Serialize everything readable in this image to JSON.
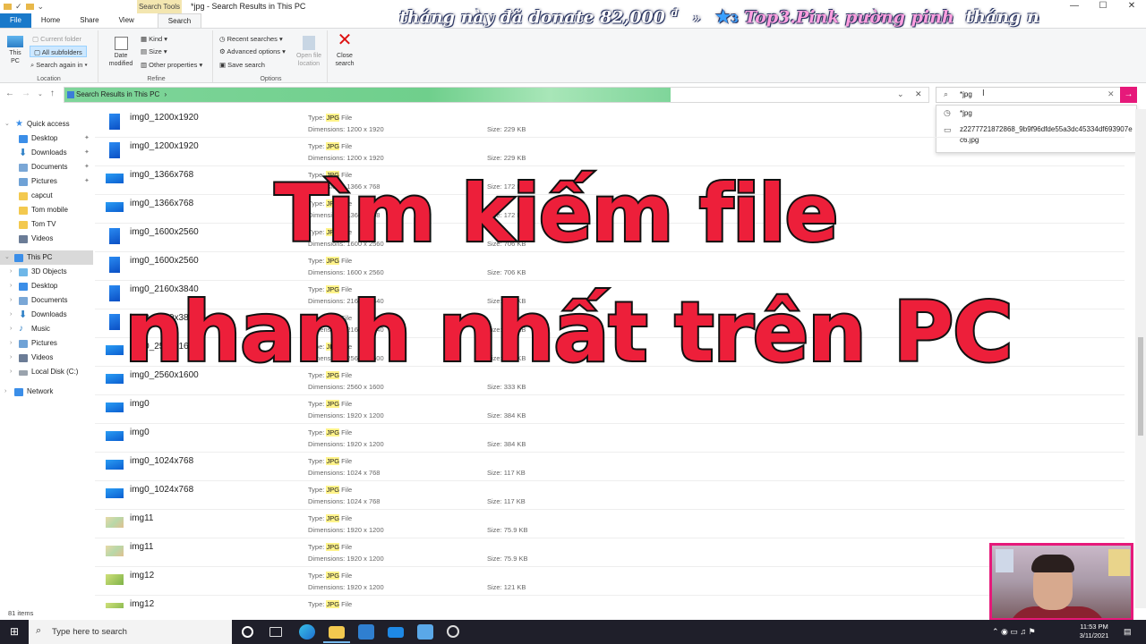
{
  "window": {
    "title": "*jpg - Search Results in This PC",
    "context_tab": "Search Tools",
    "controls": [
      "—",
      "☐",
      "✕"
    ]
  },
  "tabs": [
    "File",
    "Home",
    "Share",
    "View",
    "Search"
  ],
  "ticker": {
    "part1": "tháng này đã donate 82,000",
    "currency": "đ",
    "sep": "»",
    "rank": "3",
    "part2": "Top3.Pink pường pinh",
    "part3": "tháng này đã d"
  },
  "ribbon": {
    "location": {
      "name": "Location",
      "this_pc": "This\nPC",
      "current_folder": "Current folder",
      "all_subfolders": "All subfolders",
      "search_again": "Search again in"
    },
    "refine": {
      "name": "Refine",
      "date_modified": "Date\nmodified",
      "kind": "Kind",
      "size": "Size",
      "other_properties": "Other properties"
    },
    "options": {
      "name": "Options",
      "recent_searches": "Recent searches",
      "advanced_options": "Advanced options",
      "save_search": "Save search",
      "open_file_location": "Open file\nlocation"
    },
    "close": {
      "label": "Close\nsearch"
    }
  },
  "address": {
    "path": "Search Results in This PC",
    "sep": "›"
  },
  "search": {
    "value": "*jpg",
    "suggestions": [
      {
        "icon": "history",
        "text": "*jpg"
      },
      {
        "icon": "file",
        "text": "z2277721872868_9b9f96dfde55a3dc45334df693907ec6.jpg"
      }
    ]
  },
  "navpane": {
    "quick_access": "Quick access",
    "items": [
      "Desktop",
      "Downloads",
      "Documents",
      "Pictures",
      "capcut",
      "Tom mobile",
      "Tom TV",
      "Videos"
    ],
    "this_pc": "This PC",
    "pc_items": [
      "3D Objects",
      "Desktop",
      "Documents",
      "Downloads",
      "Music",
      "Pictures",
      "Videos",
      "Local Disk (C:)"
    ],
    "network": "Network"
  },
  "file_labels": {
    "type_prefix": "Type: ",
    "type_hl": "JPG",
    "type_suffix": " File",
    "dims_prefix": "Dimensions: ",
    "size_prefix": "Size: "
  },
  "files": [
    {
      "name": "img0_1200x1920",
      "dims": "1200 x 1920",
      "size": "229 KB",
      "kind": "blue-tall"
    },
    {
      "name": "img0_1200x1920",
      "dims": "1200 x 1920",
      "size": "229 KB",
      "kind": "blue-tall"
    },
    {
      "name": "img0_1366x768",
      "dims": "1366 x 768",
      "size": "172 KB",
      "kind": "blue-wide"
    },
    {
      "name": "img0_1366x768",
      "dims": "1366 x 768",
      "size": "172 KB",
      "kind": "blue-wide"
    },
    {
      "name": "img0_1600x2560",
      "dims": "1600 x 2560",
      "size": "706 KB",
      "kind": "blue-tall"
    },
    {
      "name": "img0_1600x2560",
      "dims": "1600 x 2560",
      "size": "706 KB",
      "kind": "blue-tall"
    },
    {
      "name": "img0_2160x3840",
      "dims": "2160 x 3840",
      "size": "695 KB",
      "kind": "blue-tall"
    },
    {
      "name": "img0_2160x3840",
      "dims": "2160 x 3840",
      "size": "695 KB",
      "kind": "blue-tall"
    },
    {
      "name": "img0_2560x1600",
      "dims": "2560 x 1600",
      "size": "333 KB",
      "kind": "blue-wide"
    },
    {
      "name": "img0_2560x1600",
      "dims": "2560 x 1600",
      "size": "333 KB",
      "kind": "blue-wide"
    },
    {
      "name": "img0",
      "dims": "1920 x 1200",
      "size": "384 KB",
      "kind": "blue-wide"
    },
    {
      "name": "img0",
      "dims": "1920 x 1200",
      "size": "384 KB",
      "kind": "blue-wide"
    },
    {
      "name": "img0_1024x768",
      "dims": "1024 x 768",
      "size": "117 KB",
      "kind": "blue-wide"
    },
    {
      "name": "img0_1024x768",
      "dims": "1024 x 768",
      "size": "117 KB",
      "kind": "blue-wide"
    },
    {
      "name": "img11",
      "dims": "1920 x 1200",
      "size": "75.9 KB",
      "kind": "map"
    },
    {
      "name": "img11",
      "dims": "1920 x 1200",
      "size": "75.9 KB",
      "kind": "map"
    },
    {
      "name": "img12",
      "dims": "1920 x 1200",
      "size": "121 KB",
      "kind": "green"
    },
    {
      "name": "img12",
      "dims": "",
      "size": "",
      "kind": "green"
    }
  ],
  "status": {
    "count": "81 items"
  },
  "overlay": {
    "line1": "Tìm kiếm file",
    "line2": "nhanh nhất trên PC"
  },
  "taskbar": {
    "search_placeholder": "Type here to search",
    "time": "11:53 PM",
    "date": "3/11/2021"
  },
  "colors": {
    "accent": "#e6197a",
    "overlay_text": "#ed1f3a",
    "file_tab": "#1979ca"
  }
}
